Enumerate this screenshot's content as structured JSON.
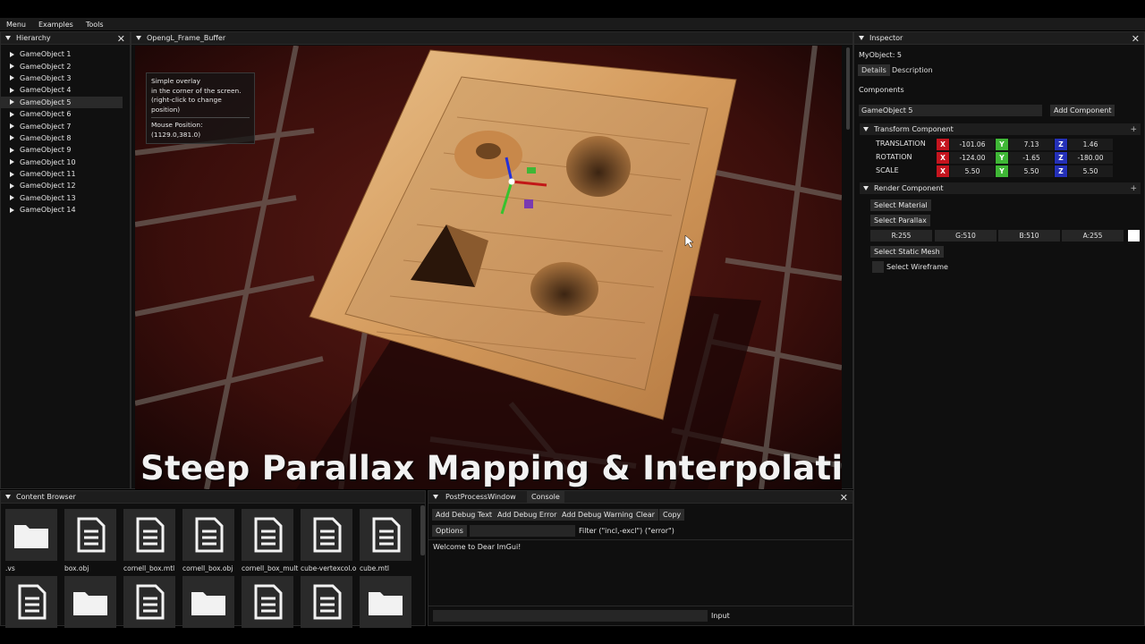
{
  "menu": [
    "Menu",
    "Examples",
    "Tools"
  ],
  "hierarchy": {
    "title": "Hierarchy",
    "items": [
      "GameObject 1",
      "GameObject 2",
      "GameObject 3",
      "GameObject 4",
      "GameObject 5",
      "GameObject 6",
      "GameObject 7",
      "GameObject 8",
      "GameObject 9",
      "GameObject 10",
      "GameObject 11",
      "GameObject 12",
      "GameObject 13",
      "GameObject 14"
    ],
    "selected": "GameObject 5"
  },
  "viewport": {
    "title": "OpengL_Frame_Buffer",
    "overlay_line1": "Simple overlay",
    "overlay_line2": "in the corner of the screen.",
    "overlay_line3": "(right-click to change position)",
    "mouse_position": "Mouse Position: (1129.0,381.0)",
    "caption": "Steep  Parallax Mapping & Interpolation"
  },
  "inspector": {
    "title": "Inspector",
    "object_name": "MyObject: 5",
    "tabs": [
      "Details",
      "Description"
    ],
    "components_label": "Components",
    "name_value": "GameObject 5",
    "add_component": "Add Component",
    "transform": {
      "header": "Transform Component",
      "translation_label": "TRANSLATION",
      "rotation_label": "ROTATION",
      "scale_label": "SCALE",
      "translation": [
        "-101.06",
        "7.13",
        "1.46"
      ],
      "rotation": [
        "-124.00",
        "-1.65",
        "-180.00"
      ],
      "scale": [
        "5.50",
        "5.50",
        "5.50"
      ],
      "axes": [
        "X",
        "Y",
        "Z"
      ]
    },
    "render": {
      "header": "Render Component",
      "select_material": "Select Material",
      "select_parallax": "Select Parallax",
      "r": "R:255",
      "g": "G:510",
      "b": "B:510",
      "a": "A:255",
      "select_static_mesh": "Select Static Mesh",
      "select_wireframe": "Select Wireframe"
    },
    "plus": "+"
  },
  "content_browser": {
    "title": "Content Browser",
    "row1": [
      {
        "name": ".vs",
        "type": "folder"
      },
      {
        "name": "box.obj",
        "type": "file"
      },
      {
        "name": "cornell_box.mtl",
        "type": "file"
      },
      {
        "name": "cornell_box.obj",
        "type": "file"
      },
      {
        "name": "cornell_box_mult",
        "type": "file"
      },
      {
        "name": "cube-vertexcol.o",
        "type": "file"
      },
      {
        "name": "cube.mtl",
        "type": "file"
      }
    ],
    "row2": [
      {
        "type": "file"
      },
      {
        "type": "folder"
      },
      {
        "type": "file"
      },
      {
        "type": "folder"
      },
      {
        "type": "file"
      },
      {
        "type": "file"
      },
      {
        "type": "folder"
      }
    ]
  },
  "console": {
    "tabs": [
      "PostProcessWindow",
      "Console"
    ],
    "buttons": [
      "Add Debug Text",
      "Add Debug Error",
      "Add Debug Warning",
      "Clear",
      "Copy"
    ],
    "options": "Options",
    "filter_label": "Filter (\"incl,-excl\") (\"error\")",
    "message": "Welcome to Dear ImGui!",
    "input_label": "Input"
  }
}
